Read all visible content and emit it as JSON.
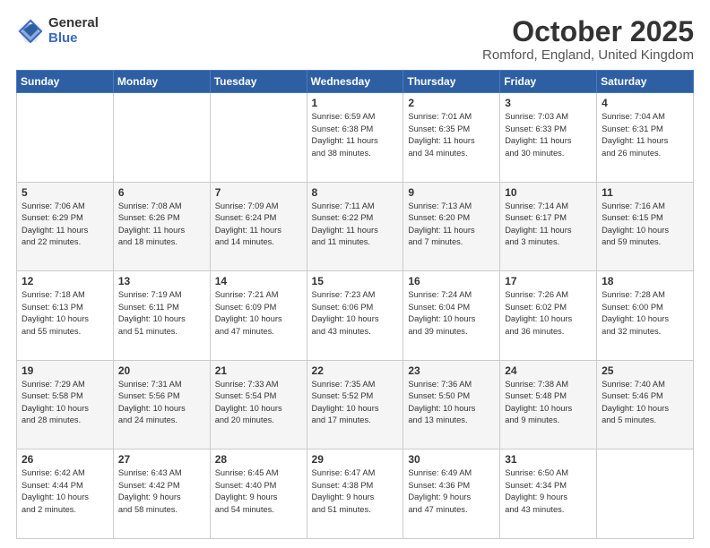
{
  "header": {
    "logo_general": "General",
    "logo_blue": "Blue",
    "title": "October 2025",
    "subtitle": "Romford, England, United Kingdom"
  },
  "weekdays": [
    "Sunday",
    "Monday",
    "Tuesday",
    "Wednesday",
    "Thursday",
    "Friday",
    "Saturday"
  ],
  "weeks": [
    [
      {
        "day": "",
        "info": ""
      },
      {
        "day": "",
        "info": ""
      },
      {
        "day": "",
        "info": ""
      },
      {
        "day": "1",
        "info": "Sunrise: 6:59 AM\nSunset: 6:38 PM\nDaylight: 11 hours\nand 38 minutes."
      },
      {
        "day": "2",
        "info": "Sunrise: 7:01 AM\nSunset: 6:35 PM\nDaylight: 11 hours\nand 34 minutes."
      },
      {
        "day": "3",
        "info": "Sunrise: 7:03 AM\nSunset: 6:33 PM\nDaylight: 11 hours\nand 30 minutes."
      },
      {
        "day": "4",
        "info": "Sunrise: 7:04 AM\nSunset: 6:31 PM\nDaylight: 11 hours\nand 26 minutes."
      }
    ],
    [
      {
        "day": "5",
        "info": "Sunrise: 7:06 AM\nSunset: 6:29 PM\nDaylight: 11 hours\nand 22 minutes."
      },
      {
        "day": "6",
        "info": "Sunrise: 7:08 AM\nSunset: 6:26 PM\nDaylight: 11 hours\nand 18 minutes."
      },
      {
        "day": "7",
        "info": "Sunrise: 7:09 AM\nSunset: 6:24 PM\nDaylight: 11 hours\nand 14 minutes."
      },
      {
        "day": "8",
        "info": "Sunrise: 7:11 AM\nSunset: 6:22 PM\nDaylight: 11 hours\nand 11 minutes."
      },
      {
        "day": "9",
        "info": "Sunrise: 7:13 AM\nSunset: 6:20 PM\nDaylight: 11 hours\nand 7 minutes."
      },
      {
        "day": "10",
        "info": "Sunrise: 7:14 AM\nSunset: 6:17 PM\nDaylight: 11 hours\nand 3 minutes."
      },
      {
        "day": "11",
        "info": "Sunrise: 7:16 AM\nSunset: 6:15 PM\nDaylight: 10 hours\nand 59 minutes."
      }
    ],
    [
      {
        "day": "12",
        "info": "Sunrise: 7:18 AM\nSunset: 6:13 PM\nDaylight: 10 hours\nand 55 minutes."
      },
      {
        "day": "13",
        "info": "Sunrise: 7:19 AM\nSunset: 6:11 PM\nDaylight: 10 hours\nand 51 minutes."
      },
      {
        "day": "14",
        "info": "Sunrise: 7:21 AM\nSunset: 6:09 PM\nDaylight: 10 hours\nand 47 minutes."
      },
      {
        "day": "15",
        "info": "Sunrise: 7:23 AM\nSunset: 6:06 PM\nDaylight: 10 hours\nand 43 minutes."
      },
      {
        "day": "16",
        "info": "Sunrise: 7:24 AM\nSunset: 6:04 PM\nDaylight: 10 hours\nand 39 minutes."
      },
      {
        "day": "17",
        "info": "Sunrise: 7:26 AM\nSunset: 6:02 PM\nDaylight: 10 hours\nand 36 minutes."
      },
      {
        "day": "18",
        "info": "Sunrise: 7:28 AM\nSunset: 6:00 PM\nDaylight: 10 hours\nand 32 minutes."
      }
    ],
    [
      {
        "day": "19",
        "info": "Sunrise: 7:29 AM\nSunset: 5:58 PM\nDaylight: 10 hours\nand 28 minutes."
      },
      {
        "day": "20",
        "info": "Sunrise: 7:31 AM\nSunset: 5:56 PM\nDaylight: 10 hours\nand 24 minutes."
      },
      {
        "day": "21",
        "info": "Sunrise: 7:33 AM\nSunset: 5:54 PM\nDaylight: 10 hours\nand 20 minutes."
      },
      {
        "day": "22",
        "info": "Sunrise: 7:35 AM\nSunset: 5:52 PM\nDaylight: 10 hours\nand 17 minutes."
      },
      {
        "day": "23",
        "info": "Sunrise: 7:36 AM\nSunset: 5:50 PM\nDaylight: 10 hours\nand 13 minutes."
      },
      {
        "day": "24",
        "info": "Sunrise: 7:38 AM\nSunset: 5:48 PM\nDaylight: 10 hours\nand 9 minutes."
      },
      {
        "day": "25",
        "info": "Sunrise: 7:40 AM\nSunset: 5:46 PM\nDaylight: 10 hours\nand 5 minutes."
      }
    ],
    [
      {
        "day": "26",
        "info": "Sunrise: 6:42 AM\nSunset: 4:44 PM\nDaylight: 10 hours\nand 2 minutes."
      },
      {
        "day": "27",
        "info": "Sunrise: 6:43 AM\nSunset: 4:42 PM\nDaylight: 9 hours\nand 58 minutes."
      },
      {
        "day": "28",
        "info": "Sunrise: 6:45 AM\nSunset: 4:40 PM\nDaylight: 9 hours\nand 54 minutes."
      },
      {
        "day": "29",
        "info": "Sunrise: 6:47 AM\nSunset: 4:38 PM\nDaylight: 9 hours\nand 51 minutes."
      },
      {
        "day": "30",
        "info": "Sunrise: 6:49 AM\nSunset: 4:36 PM\nDaylight: 9 hours\nand 47 minutes."
      },
      {
        "day": "31",
        "info": "Sunrise: 6:50 AM\nSunset: 4:34 PM\nDaylight: 9 hours\nand 43 minutes."
      },
      {
        "day": "",
        "info": ""
      }
    ]
  ]
}
